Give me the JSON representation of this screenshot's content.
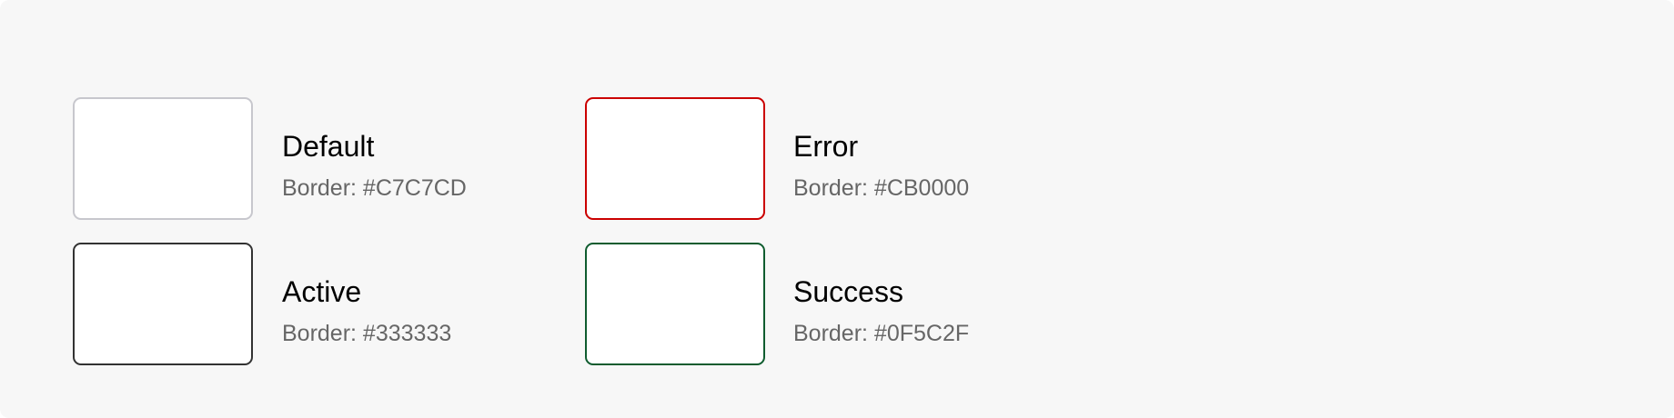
{
  "states": [
    {
      "name": "Default",
      "border_text": "Border: #C7C7CD",
      "color": "#C7C7CD"
    },
    {
      "name": "Error",
      "border_text": "Border: #CB0000",
      "color": "#CB0000"
    },
    {
      "name": "Active",
      "border_text": "Border: #333333",
      "color": "#333333"
    },
    {
      "name": "Success",
      "border_text": "Border: #0F5C2F",
      "color": "#0F5C2F"
    }
  ]
}
